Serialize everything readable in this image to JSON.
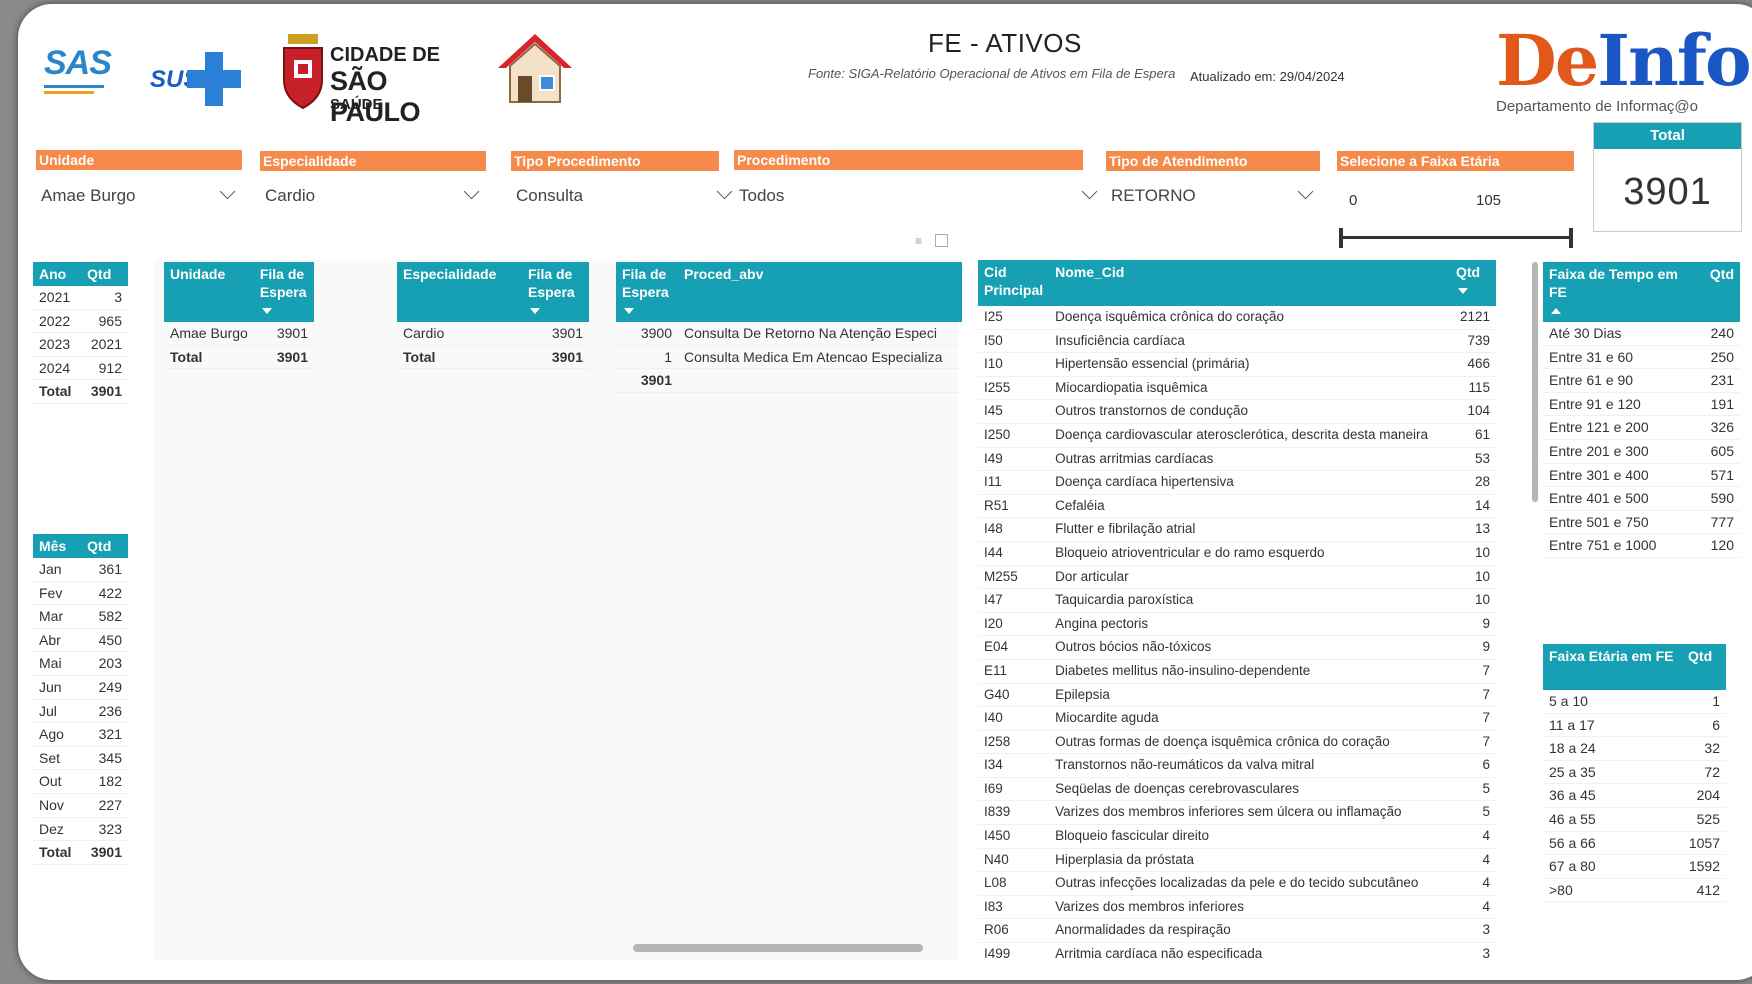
{
  "header": {
    "title": "FE - ATIVOS",
    "source": "Fonte: SIGA-Relatório Operacional de Ativos em Fila de Espera",
    "updated": "Atualizado em: 29/04/2024",
    "logo_sas": "SAS",
    "logo_sus": "SUS",
    "logo_city_line1": "CIDADE DE",
    "logo_city_line2": "SÃO PAULO",
    "logo_city_line3": "SAÚDE",
    "deinfo_de": "De",
    "deinfo_info": "Info",
    "deinfo_sub": "Departamento de Informaç@o"
  },
  "slicers": [
    {
      "label": "Unidade",
      "value": "Amae Burgo"
    },
    {
      "label": "Especialidade",
      "value": "Cardio"
    },
    {
      "label": "Tipo Procedimento",
      "value": "Consulta"
    },
    {
      "label": "Procedimento",
      "value": "Todos"
    },
    {
      "label": "Tipo de Atendimento",
      "value": "RETORNO"
    }
  ],
  "age_slicer": {
    "label": "Selecione a Faixa Etária",
    "min": "0",
    "max": "105"
  },
  "total_card": {
    "label": "Total",
    "value": "3901"
  },
  "ano_table": {
    "headers": [
      "Ano",
      "Qtd"
    ],
    "rows": [
      [
        "2021",
        "3"
      ],
      [
        "2022",
        "965"
      ],
      [
        "2023",
        "2021"
      ],
      [
        "2024",
        "912"
      ]
    ],
    "total": [
      "Total",
      "3901"
    ]
  },
  "mes_table": {
    "headers": [
      "Mês",
      "Qtd"
    ],
    "rows": [
      [
        "Jan",
        "361"
      ],
      [
        "Fev",
        "422"
      ],
      [
        "Mar",
        "582"
      ],
      [
        "Abr",
        "450"
      ],
      [
        "Mai",
        "203"
      ],
      [
        "Jun",
        "249"
      ],
      [
        "Jul",
        "236"
      ],
      [
        "Ago",
        "321"
      ],
      [
        "Set",
        "345"
      ],
      [
        "Out",
        "182"
      ],
      [
        "Nov",
        "227"
      ],
      [
        "Dez",
        "323"
      ]
    ],
    "total": [
      "Total",
      "3901"
    ]
  },
  "unidade_table": {
    "headers": [
      "Unidade",
      "Fila de Espera"
    ],
    "rows": [
      [
        "Amae Burgo",
        "3901"
      ]
    ],
    "total": [
      "Total",
      "3901"
    ]
  },
  "especialidade_table": {
    "headers": [
      "Especialidade",
      "Fila de Espera"
    ],
    "rows": [
      [
        "Cardio",
        "3901"
      ]
    ],
    "total": [
      "Total",
      "3901"
    ]
  },
  "proced_table": {
    "headers": [
      "Fila de Espera",
      "Proced_abv"
    ],
    "rows": [
      [
        "3900",
        "Consulta De Retorno Na Atenção Especi"
      ],
      [
        "1",
        "Consulta Medica Em Atencao Especializa"
      ]
    ],
    "total": "3901"
  },
  "cid_table": {
    "headers": [
      "Cid Principal",
      "Nome_Cid",
      "Qtd"
    ],
    "rows": [
      [
        "I25",
        "Doença isquêmica crônica do coração",
        "2121"
      ],
      [
        "I50",
        "Insuficiência cardíaca",
        "739"
      ],
      [
        "I10",
        "Hipertensão essencial (primária)",
        "466"
      ],
      [
        "I255",
        "Miocardiopatia isquêmica",
        "115"
      ],
      [
        "I45",
        "Outros transtornos de condução",
        "104"
      ],
      [
        "I250",
        "Doença cardiovascular aterosclerótica, descrita desta maneira",
        "61"
      ],
      [
        "I49",
        "Outras arritmias cardíacas",
        "53"
      ],
      [
        "I11",
        "Doença cardíaca hipertensiva",
        "28"
      ],
      [
        "R51",
        "Cefaléia",
        "14"
      ],
      [
        "I48",
        "Flutter e fibrilação atrial",
        "13"
      ],
      [
        "I44",
        "Bloqueio atrioventricular e do ramo esquerdo",
        "10"
      ],
      [
        "M255",
        "Dor articular",
        "10"
      ],
      [
        "I47",
        "Taquicardia paroxística",
        "10"
      ],
      [
        "I20",
        "Angina pectoris",
        "9"
      ],
      [
        "E04",
        "Outros bócios não-tóxicos",
        "9"
      ],
      [
        "E11",
        "Diabetes mellitus não-insulino-dependente",
        "7"
      ],
      [
        "G40",
        "Epilepsia",
        "7"
      ],
      [
        "I40",
        "Miocardite aguda",
        "7"
      ],
      [
        "I258",
        "Outras formas de doença isquêmica crônica do coração",
        "7"
      ],
      [
        "I34",
        "Transtornos não-reumáticos da valva mitral",
        "6"
      ],
      [
        "I69",
        "Seqüelas de doenças cerebrovasculares",
        "5"
      ],
      [
        "I839",
        "Varizes dos membros inferiores sem úlcera ou inflamação",
        "5"
      ],
      [
        "I450",
        "Bloqueio fascicular direito",
        "4"
      ],
      [
        "N40",
        "Hiperplasia da próstata",
        "4"
      ],
      [
        "L08",
        "Outras infecções localizadas da pele e do tecido subcutâneo",
        "4"
      ],
      [
        "I83",
        "Varizes dos membros inferiores",
        "4"
      ],
      [
        "R06",
        "Anormalidades da respiração",
        "3"
      ],
      [
        "I499",
        "Arritmia cardíaca não especificada",
        "3"
      ]
    ]
  },
  "tempo_table": {
    "headers": [
      "Faixa de Tempo em FE",
      "Qtd"
    ],
    "rows": [
      [
        "Até 30 Dias",
        "240"
      ],
      [
        "Entre 31 e 60",
        "250"
      ],
      [
        "Entre 61 e 90",
        "231"
      ],
      [
        "Entre 91 e 120",
        "191"
      ],
      [
        "Entre 121 e 200",
        "326"
      ],
      [
        "Entre 201 e 300",
        "605"
      ],
      [
        "Entre 301 e 400",
        "571"
      ],
      [
        "Entre 401 e 500",
        "590"
      ],
      [
        "Entre 501 e 750",
        "777"
      ],
      [
        "Entre 751 e 1000",
        "120"
      ]
    ]
  },
  "etaria_table": {
    "headers": [
      "Faixa Etária em FE",
      "Qtd"
    ],
    "rows": [
      [
        "5 a 10",
        "1"
      ],
      [
        "11 a 17",
        "6"
      ],
      [
        "18 a 24",
        "32"
      ],
      [
        "25 a 35",
        "72"
      ],
      [
        "36 a 45",
        "204"
      ],
      [
        "46 a 55",
        "525"
      ],
      [
        "56 a 66",
        "1057"
      ],
      [
        "67 a 80",
        "1592"
      ],
      [
        ">80",
        "412"
      ]
    ]
  },
  "colors": {
    "header_teal": "#17a0b3",
    "slicer_orange": "#f58a4b",
    "deinfo_orange": "#e2571a",
    "deinfo_blue": "#1a56c4"
  }
}
